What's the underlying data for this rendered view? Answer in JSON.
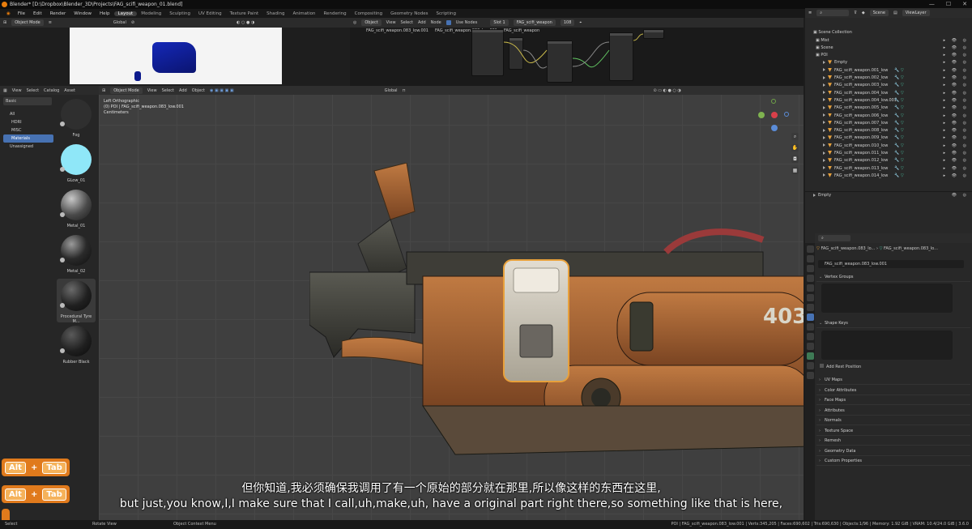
{
  "window": {
    "title": "Blender* [D:\\Dropbox\\Blender_3D\\Projects\\FAG_scifi_weapon_01.blend]",
    "controls": [
      "—",
      "☐",
      "✕"
    ]
  },
  "menubar": {
    "menus": [
      "File",
      "Edit",
      "Render",
      "Window",
      "Help"
    ],
    "workspaces": [
      "Layout",
      "Modeling",
      "Sculpting",
      "UV Editing",
      "Texture Paint",
      "Shading",
      "Animation",
      "Rendering",
      "Compositing",
      "Geometry Nodes",
      "Scripting"
    ],
    "active_workspace": "Layout"
  },
  "top_left": {
    "mode": "Object Mode",
    "transform": "Global"
  },
  "node_editor": {
    "object": "Object",
    "menus": [
      "View",
      "Select",
      "Add",
      "Node"
    ],
    "use_nodes": "Use Nodes",
    "slot": "Slot 1",
    "material": "FAG_scifi_weapon",
    "users": "108",
    "breadcrumb": [
      "FAG_scifi_weapon.083_low.001",
      "FAG_scifi_weapon.083_low.001",
      "FAG_scifi_weapon"
    ]
  },
  "asset_browser": {
    "menus": [
      "View",
      "Select",
      "Catalog",
      "Asset"
    ],
    "library": "Basic",
    "categories": [
      "All",
      "HDRI",
      "MISC",
      "Materials",
      "Unassigned"
    ],
    "selected_category": "Materials",
    "assets": [
      {
        "name": "Fog",
        "color": "#2f2f2f"
      },
      {
        "name": "GLow_01",
        "color": "#8fe7f8"
      },
      {
        "name": "Metal_01",
        "color": "#6b6b6b"
      },
      {
        "name": "Metal_02",
        "color": "#3a3a3a"
      },
      {
        "name": "Procedural Tyre M...",
        "color": "#2a2a2a"
      },
      {
        "name": "Rubber Black",
        "color": "#2c2c2c"
      }
    ]
  },
  "viewport": {
    "mode": "Object Mode",
    "menus": [
      "View",
      "Select",
      "Add",
      "Object"
    ],
    "transform": "Global",
    "view_name": "Left Orthographic",
    "collection_info": "(0) POI | FAG_scifi_weapon.083_low.001",
    "units": "Centimeters",
    "stamp": "403"
  },
  "outliner": {
    "search_placeholder": "",
    "scene": "Scene",
    "view_layer": "ViewLayer",
    "root": "Scene Collection",
    "rows": [
      {
        "label": "Mist",
        "indent": 1,
        "type": "coll"
      },
      {
        "label": "Scene",
        "indent": 1,
        "type": "coll"
      },
      {
        "label": "POI",
        "indent": 1,
        "type": "coll"
      },
      {
        "label": "Empty",
        "indent": 2,
        "type": "empty"
      },
      {
        "label": "FAG_scifi_weapon.001_low",
        "indent": 2,
        "type": "mesh"
      },
      {
        "label": "FAG_scifi_weapon.002_low",
        "indent": 2,
        "type": "mesh"
      },
      {
        "label": "FAG_scifi_weapon.003_low",
        "indent": 2,
        "type": "mesh"
      },
      {
        "label": "FAG_scifi_weapon.004_low",
        "indent": 2,
        "type": "mesh"
      },
      {
        "label": "FAG_scifi_weapon.004_low.001",
        "indent": 2,
        "type": "mesh"
      },
      {
        "label": "FAG_scifi_weapon.005_low",
        "indent": 2,
        "type": "mesh"
      },
      {
        "label": "FAG_scifi_weapon.006_low",
        "indent": 2,
        "type": "mesh"
      },
      {
        "label": "FAG_scifi_weapon.007_low",
        "indent": 2,
        "type": "mesh"
      },
      {
        "label": "FAG_scifi_weapon.008_low",
        "indent": 2,
        "type": "mesh"
      },
      {
        "label": "FAG_scifi_weapon.009_low",
        "indent": 2,
        "type": "mesh"
      },
      {
        "label": "FAG_scifi_weapon.010_low",
        "indent": 2,
        "type": "mesh"
      },
      {
        "label": "FAG_scifi_weapon.011_low",
        "indent": 2,
        "type": "mesh"
      },
      {
        "label": "FAG_scifi_weapon.012_low",
        "indent": 2,
        "type": "mesh"
      },
      {
        "label": "FAG_scifi_weapon.013_low",
        "indent": 2,
        "type": "mesh"
      },
      {
        "label": "FAG_scifi_weapon.014_low",
        "indent": 2,
        "type": "mesh"
      }
    ],
    "second_list": [
      "Empty"
    ]
  },
  "properties": {
    "breadcrumb_object": "FAG_scifi_weapon.083_lo...",
    "breadcrumb_mesh": "FAG_scifi_weapon.083_lo...",
    "data_name": "FAG_scifi_weapon.083_low.001",
    "sections_open": [
      "Vertex Groups",
      "Shape Keys"
    ],
    "add_rest_position": "Add Rest Position",
    "sections_closed": [
      "UV Maps",
      "Color Attributes",
      "Face Maps",
      "Attributes",
      "Normals",
      "Texture Space",
      "Remesh",
      "Geometry Data",
      "Custom Properties"
    ]
  },
  "key_hints": [
    {
      "k1": "Alt",
      "plus": "+",
      "k2": "Tab"
    },
    {
      "k1": "Alt",
      "plus": "+",
      "k2": "Tab"
    }
  ],
  "subtitles": {
    "zh": "但你知道,我必须确保我调用了有一个原始的部分就在那里,所以像这样的东西在这里,",
    "en": "but just,you know,I,I make sure that I call,uh,make,uh, have a original part right there,so something like that is here,"
  },
  "statusbar": {
    "left": [
      "Select",
      "Rotate View",
      "Object Context Menu"
    ],
    "right": "POI | FAG_scifi_weapon.083_low.001 | Verts:345,205 | Faces:690,602 | Tris:690,630 | Objects:1/96 | Memory: 1.92 GiB | VRAM: 10.4/24.0 GiB | 3.6.0"
  },
  "colors": {
    "accent": "#4772b3",
    "selection": "#e8a13c",
    "blender_orange": "#e87d0d"
  }
}
